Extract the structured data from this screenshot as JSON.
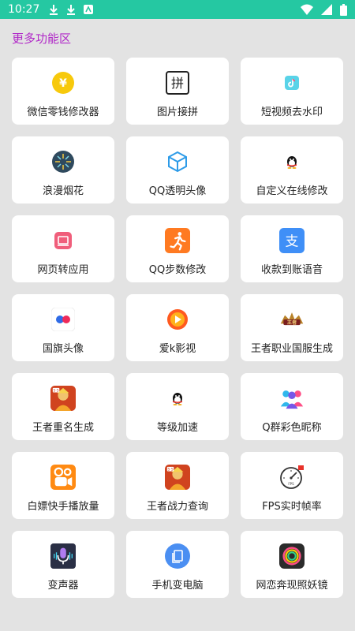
{
  "status_bar": {
    "time": "10:27",
    "left_icons": [
      "download-icon",
      "download-icon",
      "notification-icon"
    ],
    "right_icons": [
      "wifi-icon",
      "signal-icon",
      "battery-icon"
    ]
  },
  "section": {
    "title": "更多功能区"
  },
  "colors": {
    "status_bar": "#25c8a2",
    "section_title": "#b12ac8",
    "background": "#e3e3e3"
  },
  "features": [
    {
      "label": "微信零钱修改器",
      "icon": "yen-coin-icon"
    },
    {
      "label": "图片接拼",
      "icon": "pin-text-icon"
    },
    {
      "label": "短视频去水印",
      "icon": "tiktok-icon"
    },
    {
      "label": "浪漫烟花",
      "icon": "fireworks-icon"
    },
    {
      "label": "QQ透明头像",
      "icon": "cube-icon"
    },
    {
      "label": "自定义在线修改",
      "icon": "qq-penguin-icon"
    },
    {
      "label": "网页转应用",
      "icon": "web-app-icon"
    },
    {
      "label": "QQ步数修改",
      "icon": "running-man-icon"
    },
    {
      "label": "收款到账语音",
      "icon": "alipay-icon"
    },
    {
      "label": "国旗头像",
      "icon": "flickr-dots-icon"
    },
    {
      "label": "爱k影视",
      "icon": "play-icon"
    },
    {
      "label": "王者职业国服生成",
      "icon": "honor-of-kings-logo-icon"
    },
    {
      "label": "王者重名生成",
      "icon": "game-hero-icon"
    },
    {
      "label": "等级加速",
      "icon": "qq-penguin-icon"
    },
    {
      "label": "Q群彩色昵称",
      "icon": "group-users-icon"
    },
    {
      "label": "白嫖快手播放量",
      "icon": "kuaishou-icon"
    },
    {
      "label": "王者战力查询",
      "icon": "game-hero-icon"
    },
    {
      "label": "FPS实时帧率",
      "icon": "fps-gauge-icon"
    },
    {
      "label": "变声器",
      "icon": "microphone-icon"
    },
    {
      "label": "手机变电脑",
      "icon": "copy-phone-icon"
    },
    {
      "label": "网恋奔现照妖镜",
      "icon": "mirror-ring-icon"
    }
  ]
}
